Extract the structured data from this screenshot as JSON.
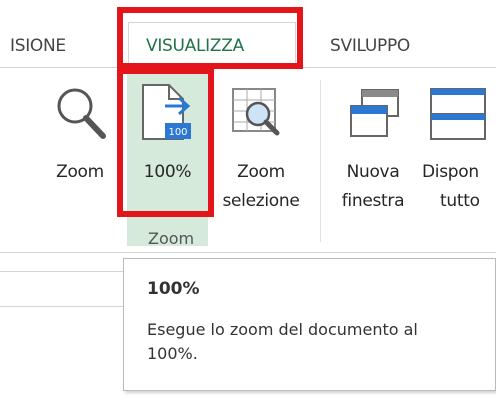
{
  "tabs": [
    {
      "label": "ISIONE"
    },
    {
      "label": "VISUALIZZA"
    },
    {
      "label": "SVILUPPO"
    }
  ],
  "ribbon": {
    "zoom_group_label": "Zoom",
    "buttons": {
      "zoom": {
        "label": "Zoom"
      },
      "zoom_100": {
        "label": "100%",
        "badge": "100"
      },
      "zoom_selection": {
        "line1": "Zoom",
        "line2": "selezione"
      },
      "new_window": {
        "line1": "Nuova",
        "line2": "finestra"
      },
      "arrange_all": {
        "line1": "Dispon",
        "line2": "tutto"
      }
    }
  },
  "tooltip": {
    "title": "100%",
    "description": "Esegue lo zoom del documento al 100%."
  },
  "colors": {
    "accent_green": "#217346",
    "highlight_bg": "#d5eadb",
    "annotation_red": "#e4141b",
    "icon_blue": "#2b78d4"
  },
  "icons": [
    "magnifier-icon",
    "page-zoom-100-icon",
    "zoom-selection-icon",
    "new-window-icon",
    "arrange-all-icon"
  ]
}
